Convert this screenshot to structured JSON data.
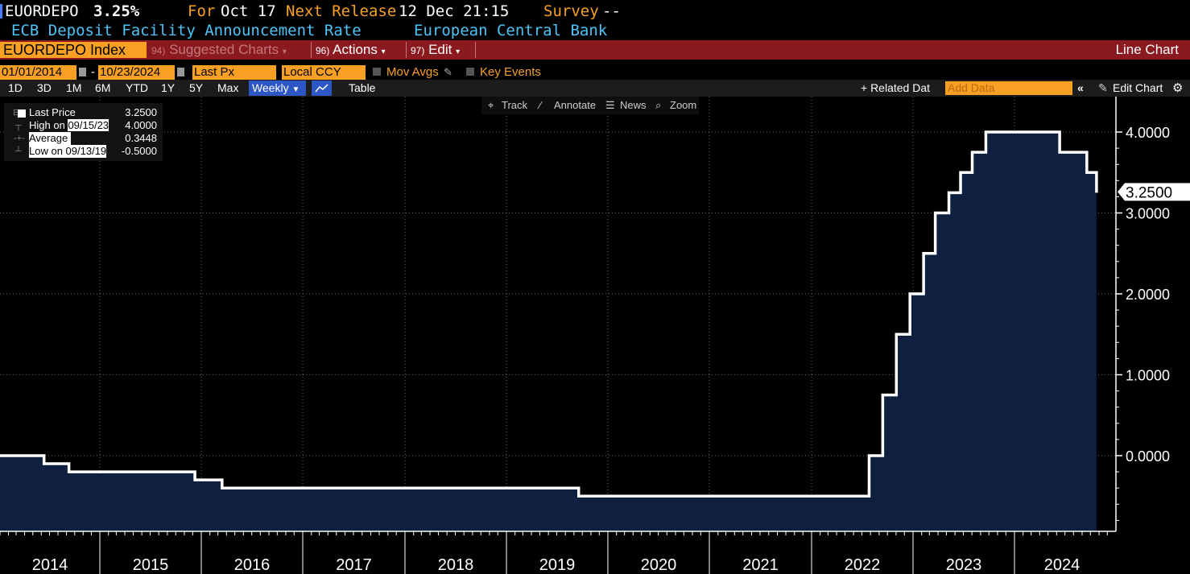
{
  "header": {
    "ticker": "EUORDEPO",
    "value": "3.25%",
    "for_label": "For",
    "for_date": "Oct 17",
    "next_release_label": "Next Release",
    "next_release_value": "12 Dec 21:15",
    "survey_label": "Survey",
    "survey_value": "--",
    "description": "ECB Deposit Facility Announcement Rate",
    "source": "European Central Bank"
  },
  "toolbar": {
    "security": "EUORDEPO Index",
    "suggested_num": "94)",
    "suggested": "Suggested Charts",
    "actions_num": "96)",
    "actions": "Actions",
    "edit_num": "97)",
    "edit": "Edit",
    "chart_type": "Line Chart"
  },
  "controls": {
    "start_date": "01/01/2014",
    "separator": "-",
    "end_date": "10/23/2024",
    "field": "Last Px",
    "currency": "Local CCY",
    "mov_avgs": "Mov Avgs",
    "key_events": "Key Events"
  },
  "ranges": {
    "buttons": [
      "1D",
      "3D",
      "1M",
      "6M",
      "YTD",
      "1Y",
      "5Y",
      "Max"
    ],
    "frequency": "Weekly",
    "table": "Table",
    "related": "+ Related Dat",
    "add_data_placeholder": "Add Data",
    "edit_chart": "Edit Chart"
  },
  "chart_tools": {
    "track": "Track",
    "annotate": "Annotate",
    "news": "News",
    "zoom": "Zoom"
  },
  "legend": {
    "last_label": "Last Price",
    "last_value": "3.2500",
    "high_label": "High on",
    "high_date": "09/15/23",
    "high_value": "4.0000",
    "avg_label": "Average",
    "avg_value": "0.3448",
    "low_label": "Low on",
    "low_date": "09/13/19",
    "low_value": "-0.5000"
  },
  "colors": {
    "line": "#ffffff",
    "area": "#0f1f3f",
    "grid": "#6a6a6a",
    "accent": "#f7a023",
    "link": "#4fc3f7"
  },
  "chart_data": {
    "type": "area",
    "title": "",
    "xlabel": "",
    "ylabel": "",
    "last_value_label": "3.2500",
    "x_range": [
      "2014-01-01",
      "2024-10-23"
    ],
    "ylim": [
      -0.9,
      4.0
    ],
    "y_ticks": [
      "4.0000",
      "3.0000",
      "2.0000",
      "1.0000",
      "0.0000"
    ],
    "x_ticks": [
      "2014",
      "2015",
      "2016",
      "2017",
      "2018",
      "2019",
      "2020",
      "2021",
      "2022",
      "2023",
      "2024"
    ],
    "grid": true,
    "legend_position": "top-left",
    "series": [
      {
        "name": "Last Price",
        "step": true,
        "points": [
          {
            "date": "2014-01-01",
            "value": 0.0
          },
          {
            "date": "2014-06-11",
            "value": -0.1
          },
          {
            "date": "2014-09-10",
            "value": -0.2
          },
          {
            "date": "2015-12-09",
            "value": -0.3
          },
          {
            "date": "2016-03-16",
            "value": -0.4
          },
          {
            "date": "2019-09-18",
            "value": -0.5
          },
          {
            "date": "2022-07-27",
            "value": 0.0
          },
          {
            "date": "2022-09-14",
            "value": 0.75
          },
          {
            "date": "2022-11-02",
            "value": 1.5
          },
          {
            "date": "2022-12-21",
            "value": 2.0
          },
          {
            "date": "2023-02-08",
            "value": 2.5
          },
          {
            "date": "2023-03-22",
            "value": 3.0
          },
          {
            "date": "2023-05-10",
            "value": 3.25
          },
          {
            "date": "2023-06-21",
            "value": 3.5
          },
          {
            "date": "2023-08-02",
            "value": 3.75
          },
          {
            "date": "2023-09-20",
            "value": 4.0
          },
          {
            "date": "2024-06-12",
            "value": 3.75
          },
          {
            "date": "2024-09-18",
            "value": 3.5
          },
          {
            "date": "2024-10-23",
            "value": 3.25
          }
        ]
      }
    ]
  }
}
